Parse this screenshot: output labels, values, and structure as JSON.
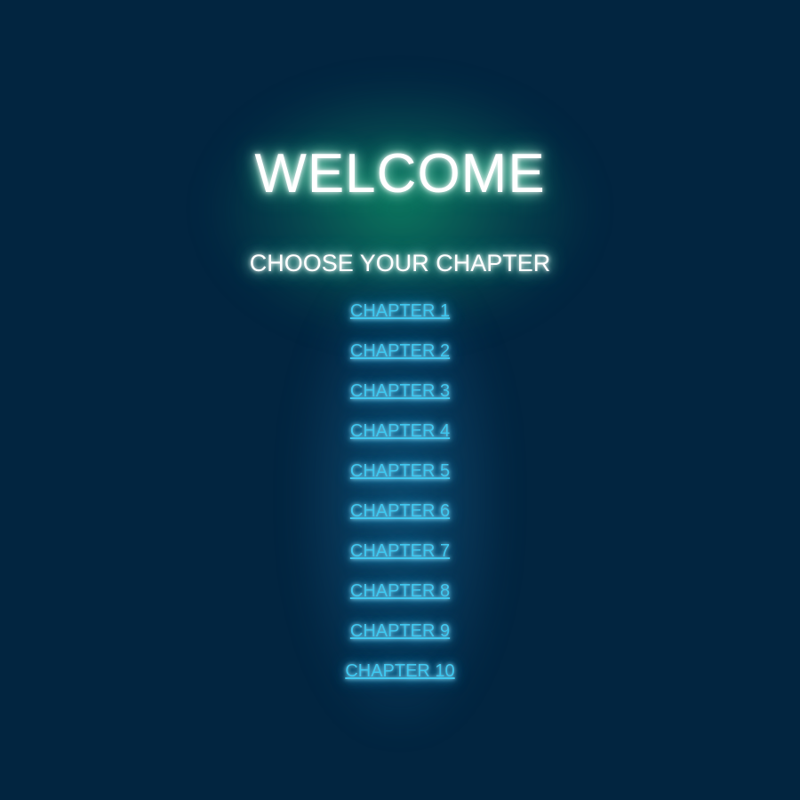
{
  "page": {
    "title": "WELCOME",
    "subtitle": "CHOOSE YOUR CHAPTER"
  },
  "chapters": [
    {
      "label": "CHAPTER 1"
    },
    {
      "label": "CHAPTER 2"
    },
    {
      "label": "CHAPTER 3"
    },
    {
      "label": "CHAPTER 4"
    },
    {
      "label": "CHAPTER 5"
    },
    {
      "label": "CHAPTER 6"
    },
    {
      "label": "CHAPTER 7"
    },
    {
      "label": "CHAPTER 8"
    },
    {
      "label": "CHAPTER 9"
    },
    {
      "label": "CHAPTER 10"
    }
  ],
  "colors": {
    "background": "#022540",
    "title_glow": "#38e0a0",
    "link": "#3ec8f0"
  }
}
